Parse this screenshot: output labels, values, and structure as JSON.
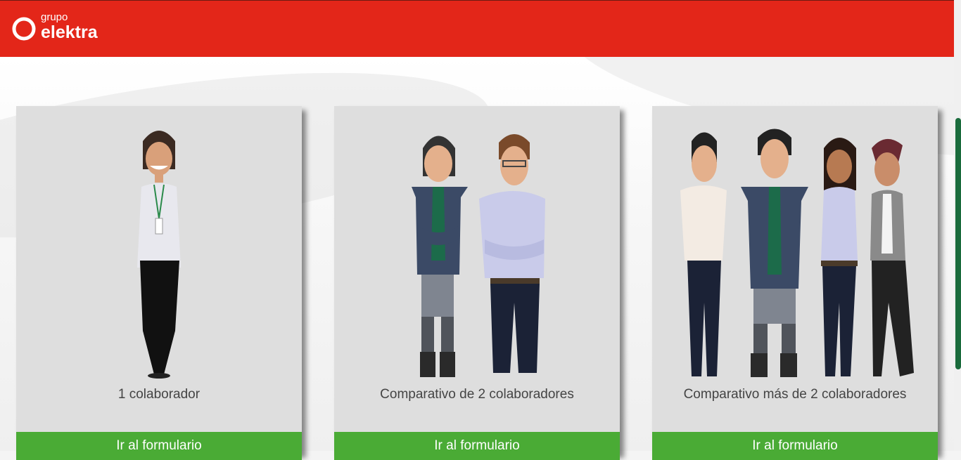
{
  "header": {
    "brand_small": "grupo",
    "brand_big": "elektra",
    "background_color": "#e32619"
  },
  "cards": [
    {
      "label": "1 colaborador",
      "button": "Ir al formulario"
    },
    {
      "label": "Comparativo de 2 colaboradores",
      "button": "Ir al formulario"
    },
    {
      "label": "Comparativo más de 2 colaboradores",
      "button": "Ir al formulario"
    }
  ],
  "colors": {
    "button_green": "#4aab35",
    "card_bg": "#dedede",
    "scroll_thumb": "#1a6b3c"
  }
}
